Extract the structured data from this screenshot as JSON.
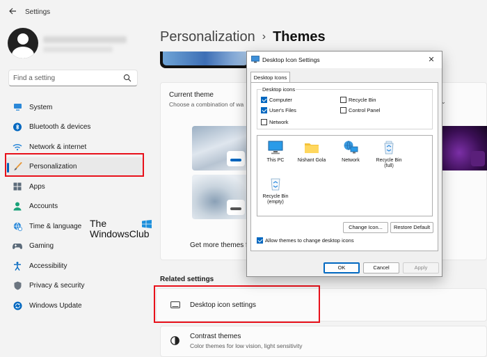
{
  "window": {
    "app_title": "Settings"
  },
  "sidebar": {
    "search_placeholder": "Find a setting",
    "items": [
      {
        "label": "System",
        "icon": "monitor-icon",
        "active": false
      },
      {
        "label": "Bluetooth & devices",
        "icon": "bluetooth-icon",
        "active": false
      },
      {
        "label": "Network & internet",
        "icon": "wifi-icon",
        "active": false
      },
      {
        "label": "Personalization",
        "icon": "brush-icon",
        "active": true
      },
      {
        "label": "Apps",
        "icon": "apps-icon",
        "active": false
      },
      {
        "label": "Accounts",
        "icon": "person-icon",
        "active": false
      },
      {
        "label": "Time & language",
        "icon": "globe-clock-icon",
        "active": false
      },
      {
        "label": "Gaming",
        "icon": "gamepad-icon",
        "active": false
      },
      {
        "label": "Accessibility",
        "icon": "accessibility-icon",
        "active": false
      },
      {
        "label": "Privacy & security",
        "icon": "shield-icon",
        "active": false
      },
      {
        "label": "Windows Update",
        "icon": "refresh-icon",
        "active": false
      }
    ]
  },
  "watermark": {
    "line1": "The",
    "line2": "WindowsClub"
  },
  "main": {
    "breadcrumb": {
      "parent": "Personalization",
      "separator": "›",
      "current": "Themes"
    },
    "current_theme": {
      "title": "Current theme",
      "subtitle": "Choose a combination of wa"
    },
    "get_more_themes": "Get more themes fr",
    "related_settings": "Related settings",
    "desktop_icon_settings": "Desktop icon settings",
    "contrast_themes": {
      "title": "Contrast themes",
      "subtitle": "Color themes for low vision, light sensitivity"
    }
  },
  "dialog": {
    "title": "Desktop Icon Settings",
    "close": "✕",
    "tab": "Desktop Icons",
    "group_label": "Desktop icons",
    "checkboxes": [
      {
        "label": "Computer",
        "checked": true
      },
      {
        "label": "User's Files",
        "checked": true
      },
      {
        "label": "Network",
        "checked": false
      },
      {
        "label": "Recycle Bin",
        "checked": false
      },
      {
        "label": "Control Panel",
        "checked": false
      }
    ],
    "icons": [
      {
        "label": "This PC",
        "icon": "this-pc-icon"
      },
      {
        "label": "Nishant Gola",
        "icon": "folder-icon"
      },
      {
        "label": "Network",
        "icon": "network-icon"
      },
      {
        "label": "Recycle Bin (full)",
        "icon": "recycle-bin-full-icon"
      },
      {
        "label": "Recycle Bin (empty)",
        "icon": "recycle-bin-empty-icon"
      }
    ],
    "change_icon": "Change Icon...",
    "restore_default": "Restore Default",
    "allow_themes": {
      "label": "Allow themes to change desktop icons",
      "checked": true
    },
    "ok": "OK",
    "cancel": "Cancel",
    "apply": "Apply"
  },
  "colors": {
    "accent": "#0067c0",
    "highlight_box": "#e8101a"
  }
}
